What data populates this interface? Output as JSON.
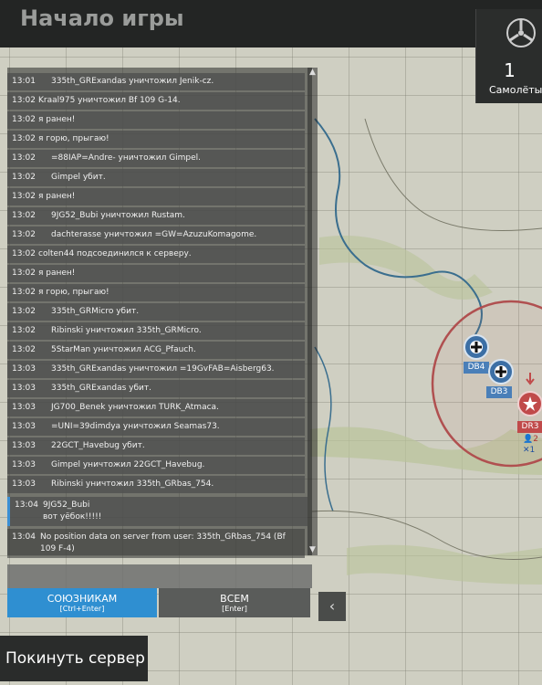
{
  "header": {
    "title": "Начало игры"
  },
  "planes": {
    "count": "1",
    "label": "Самолёты"
  },
  "chat": {
    "messages": [
      {
        "time": "13:01",
        "text": "335th_GRExandas уничтожил Jenik-cz.",
        "indent": true
      },
      {
        "time": "13:02",
        "text": "Kraal975 уничтожил Bf 109 G-14.",
        "indent": false
      },
      {
        "time": "13:02",
        "text": "я ранен!",
        "indent": false
      },
      {
        "time": "13:02",
        "text": "я горю, прыгаю!",
        "indent": false
      },
      {
        "time": "13:02",
        "text": "=88IAP=Andre- уничтожил Gimpel.",
        "indent": true
      },
      {
        "time": "13:02",
        "text": "Gimpel убит.",
        "indent": true
      },
      {
        "time": "13:02",
        "text": "я ранен!",
        "indent": false
      },
      {
        "time": "13:02",
        "text": "9JG52_Bubi уничтожил Rustam.",
        "indent": true
      },
      {
        "time": "13:02",
        "text": "dachterasse уничтожил =GW=AzuzuKomagome.",
        "indent": true
      },
      {
        "time": "13:02",
        "text": "colten44 подсоединился к серверу.",
        "indent": false
      },
      {
        "time": "13:02",
        "text": "я ранен!",
        "indent": false
      },
      {
        "time": "13:02",
        "text": "я горю, прыгаю!",
        "indent": false
      },
      {
        "time": "13:02",
        "text": "335th_GRMicro убит.",
        "indent": true
      },
      {
        "time": "13:02",
        "text": "Ribinski уничтожил 335th_GRMicro.",
        "indent": true
      },
      {
        "time": "13:02",
        "text": "5StarMan уничтожил ACG_Pfauch.",
        "indent": true
      },
      {
        "time": "13:03",
        "text": "335th_GRExandas уничтожил =19GvFAB=Aisberg63.",
        "indent": true
      },
      {
        "time": "13:03",
        "text": "335th_GRExandas убит.",
        "indent": true
      },
      {
        "time": "13:03",
        "text": "JG700_Benek уничтожил TURK_Atmaca.",
        "indent": true
      },
      {
        "time": "13:03",
        "text": "=UNI=39dimdya уничтожил Seamas73.",
        "indent": true
      },
      {
        "time": "13:03",
        "text": "22GCT_Havebug убит.",
        "indent": true
      },
      {
        "time": "13:03",
        "text": "Gimpel уничтожил 22GCT_Havebug.",
        "indent": true
      },
      {
        "time": "13:03",
        "text": "Ribinski уничтожил 335th_GRbas_754.",
        "indent": true
      }
    ],
    "last_user": {
      "time": "13:04",
      "line1": "9JG52_Bubi",
      "line2": "вот уёбок!!!!!"
    },
    "last_system": {
      "time": "13:04",
      "text": "No position data on server from user: 335th_GRbas_754 (Bf 109 F-4)"
    }
  },
  "buttons": {
    "allies_label": "СОЮЗНИКАМ",
    "allies_shortcut": "[Ctrl+Enter]",
    "all_label": "ВСЕМ",
    "all_shortcut": "[Enter]",
    "leave_label": "Покинуть сервер"
  },
  "map": {
    "units": [
      {
        "label": "DB4"
      },
      {
        "label": "DB3"
      },
      {
        "label": "DR3"
      }
    ],
    "enemy_count": "2",
    "ally_count": "1",
    "colors": {
      "blue_unit": "#3c6fa5",
      "red_unit": "#c04a4a",
      "zone_ring": "#b05050",
      "river": "#3a6e8e"
    }
  },
  "icons": [
    "propeller-icon",
    "cross-marker-icon",
    "star-marker-icon",
    "cursor-icon",
    "chevron-left-icon",
    "scroll-up-icon",
    "scroll-down-icon"
  ]
}
